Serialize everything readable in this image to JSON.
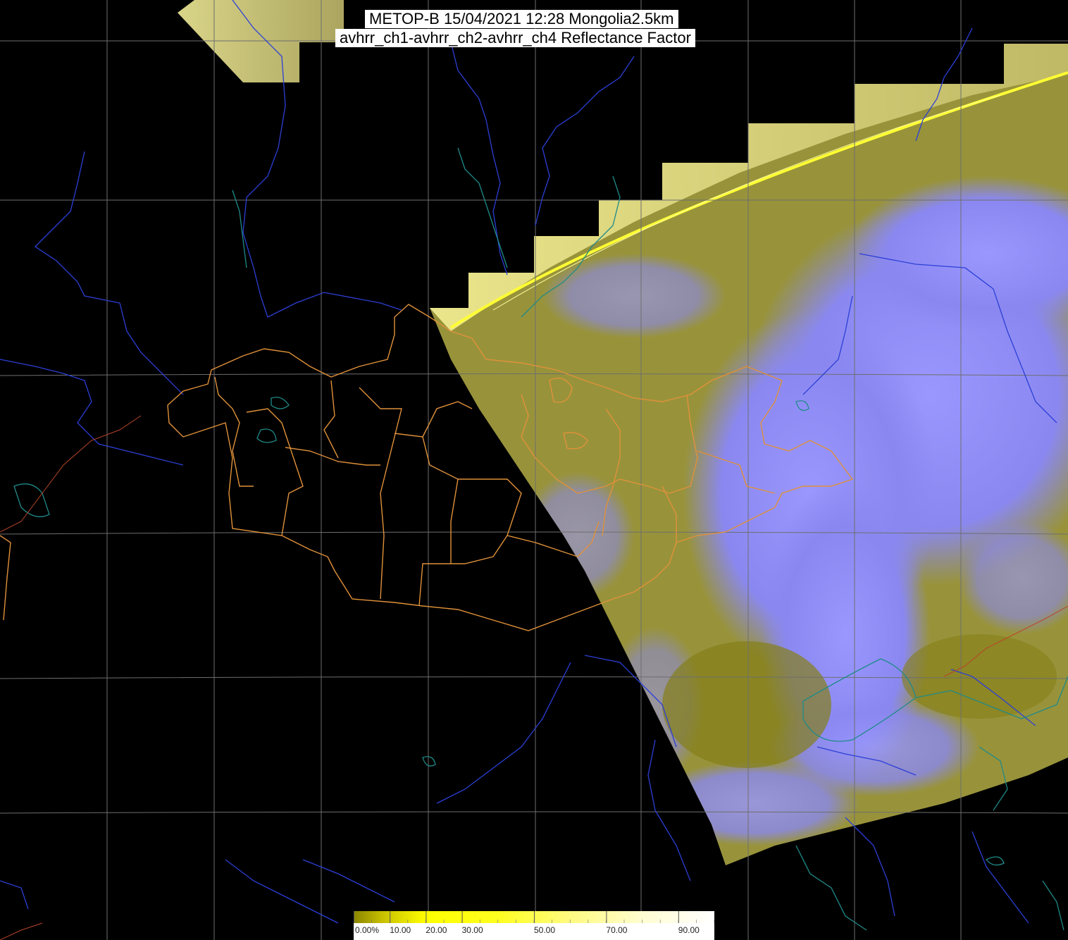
{
  "header": {
    "line1": "METOP-B 15/04/2021 12:28 Mongolia2.5km",
    "line2": "avhrr_ch1-avhrr_ch2-avhrr_ch4 Reflectance Factor"
  },
  "colorbar": {
    "ticks": [
      {
        "label": "0.00%",
        "value": 0
      },
      {
        "label": "10.00",
        "value": 10
      },
      {
        "label": "20.00",
        "value": 20
      },
      {
        "label": "30.00",
        "value": 30
      },
      {
        "label": "50.00",
        "value": 50
      },
      {
        "label": "70.00",
        "value": 70
      },
      {
        "label": "90.00",
        "value": 90
      }
    ],
    "range": [
      0,
      100
    ]
  },
  "colors": {
    "background": "#000000",
    "cloud": "#8a88f4",
    "land": "#8f8a2a",
    "grid": "#6e6e6e",
    "admin_border": "#e0913a",
    "river": "#2c3fd6",
    "coast": "#1f8a88",
    "swath_edge": "#ffff33"
  }
}
